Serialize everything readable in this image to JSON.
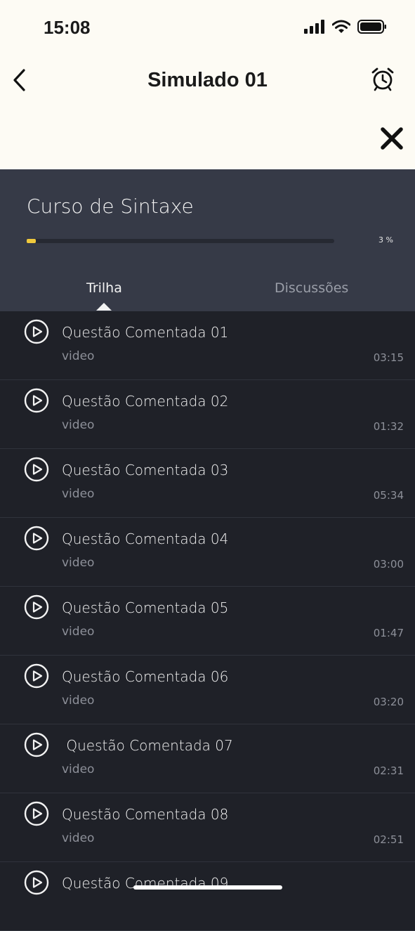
{
  "status_bar": {
    "time": "15:08"
  },
  "nav": {
    "title": "Simulado 01",
    "back_icon": "chevron-left-icon",
    "alarm_icon": "alarm-clock-icon",
    "close_icon": "close-icon"
  },
  "course": {
    "title": "Curso de Sintaxe",
    "progress_value": 3,
    "progress_label": "3 %",
    "accent_color": "#f0c93c"
  },
  "tabs": [
    {
      "label": "Trilha",
      "active": true
    },
    {
      "label": "Discussões",
      "active": false
    }
  ],
  "lessons": [
    {
      "title": "Questão Comentada 01",
      "type": "video",
      "duration": "03:15"
    },
    {
      "title": "Questão Comentada 02",
      "type": "video",
      "duration": "01:32"
    },
    {
      "title": "Questão Comentada 03",
      "type": "video",
      "duration": "05:34"
    },
    {
      "title": "Questão Comentada 04",
      "type": "video",
      "duration": "03:00"
    },
    {
      "title": "Questão Comentada 05",
      "type": "video",
      "duration": "01:47"
    },
    {
      "title": "Questão Comentada 06",
      "type": "video",
      "duration": "03:20"
    },
    {
      "title": " Questão Comentada 07",
      "type": "video",
      "duration": "02:31"
    },
    {
      "title": "Questão Comentada 08",
      "type": "video",
      "duration": "02:51"
    },
    {
      "title": "Questão Comentada 09",
      "type": "",
      "duration": ""
    }
  ]
}
